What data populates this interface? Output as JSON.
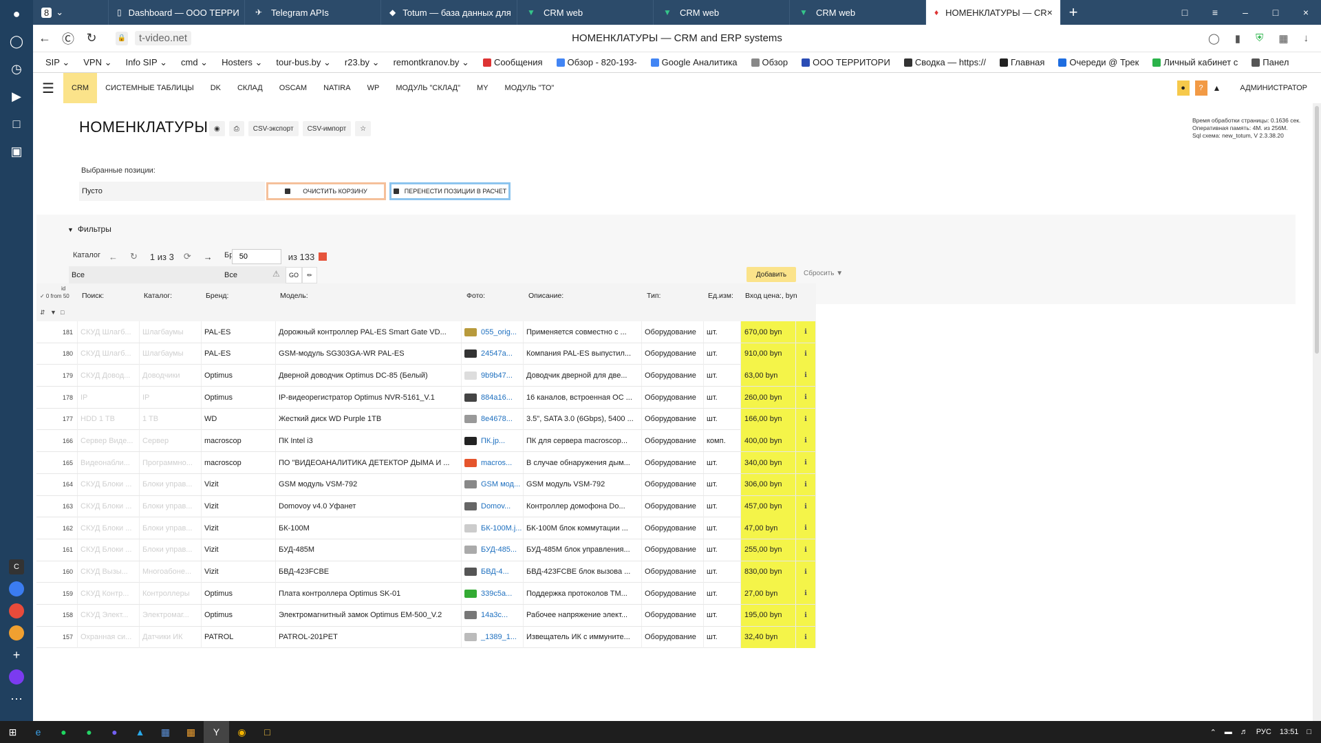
{
  "browser": {
    "tab_counter": "8",
    "tabs": [
      {
        "label": "Dashboard — ООО ТЕРРИ",
        "icon": "▯"
      },
      {
        "label": "Telegram APIs",
        "icon": "✈"
      },
      {
        "label": "Totum — база данных для",
        "icon": "◆"
      },
      {
        "label": "CRM web",
        "icon": "▼"
      },
      {
        "label": "CRM web",
        "icon": "▼"
      },
      {
        "label": "CRM web",
        "icon": "▼"
      },
      {
        "label": "НОМЕНКЛАТУРЫ — CR",
        "icon": "♦"
      }
    ],
    "url": "t-video.net",
    "page_title": "НОМЕНКЛАТУРЫ — CRM and ERP systems",
    "bookmarks": [
      "SIP ⌄",
      "VPN ⌄",
      "Info SIP ⌄",
      "cmd ⌄",
      "Hosters ⌄",
      "tour-bus.by ⌄",
      "r23.by ⌄",
      "remontkranov.by ⌄",
      "Сообщения",
      "Обзор - 820-193-",
      "Google Аналитика",
      "Обзор",
      "ООО ТЕРРИТОРИ",
      "Сводка — https://",
      "Главная",
      "Очереди @ Трек",
      "Личный кабинет с",
      "Панел"
    ]
  },
  "nav": {
    "items": [
      "CRM",
      "СИСТЕМНЫЕ ТАБЛИЦЫ",
      "DK",
      "СКЛАД",
      "OSCAM",
      "NATIRA",
      "WP",
      "МОДУЛЬ \"СКЛАД\"",
      "MY",
      "МОДУЛЬ \"ТО\""
    ],
    "active": 0,
    "user": "АДМИНИСТРАТОР",
    "help": "?"
  },
  "page": {
    "title": "НОМЕНКЛАТУРЫ",
    "csv_export": "CSV-экспорт",
    "csv_import": "CSV-импорт",
    "stats": [
      "Время обработки страницы: 0.1636 сек.",
      "Оперативная память: 4M. из 256M.",
      "Sql схема: new_totum, V 2.3.38.20"
    ],
    "selected_label": "Выбранные позиции:",
    "selected_value": "Пусто",
    "clear_cart": "ОЧИСТИТЬ КОРЗИНУ",
    "move_positions": "ПЕРЕНЕСТИ ПОЗИЦИИ В РАСЧЕТ",
    "filters_title": "Фильтры",
    "filter_catalog_label": "Каталог",
    "filter_catalog_value": "Все",
    "filter_brand_label": "Бренд",
    "filter_brand_value": "Все",
    "go": "GO",
    "pager_text": "1 из 3",
    "pager_size": "50",
    "pager_total": "из 133",
    "add_button": "Добавить",
    "reset_button": "Сбросить"
  },
  "table": {
    "id_header": "id",
    "check_header": "✓ 0 from 50",
    "headers": [
      "Поиск:",
      "Каталог:",
      "Бренд:",
      "Модель:",
      "Фото:",
      "Описание:",
      "Тип:",
      "Ед.изм:",
      "Вход цена:, byn"
    ],
    "rows": [
      {
        "id": "181",
        "search": "СКУД Шлагб...",
        "catalog": "Шлагбаумы",
        "brand": "PAL-ES",
        "model": "Дорожный контроллер PAL-ES Smart Gate VD...",
        "photo": "055_orig...",
        "desc": "Применяется совместно с ...",
        "type": "Оборудование",
        "unit": "шт.",
        "price": "670,00 byn"
      },
      {
        "id": "180",
        "search": "СКУД Шлагб...",
        "catalog": "Шлагбаумы",
        "brand": "PAL-ES",
        "model": "GSM-модуль SG303GA-WR PAL-ES",
        "photo": "24547а...",
        "desc": "Компания PAL-ES выпустил...",
        "type": "Оборудование",
        "unit": "шт.",
        "price": "910,00 byn"
      },
      {
        "id": "179",
        "search": "СКУД Довод...",
        "catalog": "Доводчики",
        "brand": "Optimus",
        "model": "Дверной доводчик Optimus DC-85 (Белый)",
        "photo": "9b9b47...",
        "desc": "Доводчик дверной для две...",
        "type": "Оборудование",
        "unit": "шт.",
        "price": "63,00 byn"
      },
      {
        "id": "178",
        "search": "IP",
        "catalog": "IP",
        "brand": "Optimus",
        "model": "IP-видеорегистратор Optimus NVR-5161_V.1",
        "photo": "884a16...",
        "desc": "16 каналов, встроенная ОС ...",
        "type": "Оборудование",
        "unit": "шт.",
        "price": "260,00 byn"
      },
      {
        "id": "177",
        "search": "HDD 1 TB",
        "catalog": "1 TB",
        "brand": "WD",
        "model": "Жесткий диск WD Purple 1TB",
        "photo": "8e4678...",
        "desc": "3.5\", SATA 3.0 (6Gbps), 5400 ...",
        "type": "Оборудование",
        "unit": "шт.",
        "price": "166,00 byn"
      },
      {
        "id": "166",
        "search": "Сервер Виде...",
        "catalog": "Сервер",
        "brand": "macroscop",
        "model": "ПК Intel i3",
        "photo": "ПК.jp...",
        "desc": "ПК для сервера macroscop...",
        "type": "Оборудование",
        "unit": "комп.",
        "price": "400,00 byn"
      },
      {
        "id": "165",
        "search": "Видеонабли...",
        "catalog": "Программно...",
        "brand": "macroscop",
        "model": "ПО \"ВИДЕОАНАЛИТИКА ДЕТЕКТОР ДЫМА И ...",
        "photo": "macros...",
        "desc": "В случае обнаружения дым...",
        "type": "Оборудование",
        "unit": "шт.",
        "price": "340,00 byn"
      },
      {
        "id": "164",
        "search": "СКУД Блоки ...",
        "catalog": "Блоки управ...",
        "brand": "Vizit",
        "model": "GSM модуль VSM-792",
        "photo": "GSM мод...",
        "desc": "GSM модуль VSM-792",
        "type": "Оборудование",
        "unit": "шт.",
        "price": "306,00 byn"
      },
      {
        "id": "163",
        "search": "СКУД Блоки ...",
        "catalog": "Блоки управ...",
        "brand": "Vizit",
        "model": "Domovoy v4.0 Уфанет",
        "photo": "Domov...",
        "desc": "Контроллер домофона Do...",
        "type": "Оборудование",
        "unit": "шт.",
        "price": "457,00 byn"
      },
      {
        "id": "162",
        "search": "СКУД Блоки ...",
        "catalog": "Блоки управ...",
        "brand": "Vizit",
        "model": "БК-100М",
        "photo": "БК-100М.j...",
        "desc": "БК-100М блок коммутации ...",
        "type": "Оборудование",
        "unit": "шт.",
        "price": "47,00 byn"
      },
      {
        "id": "161",
        "search": "СКУД Блоки ...",
        "catalog": "Блоки управ...",
        "brand": "Vizit",
        "model": "БУД-485М",
        "photo": "БУД-485...",
        "desc": "БУД-485М блок управления...",
        "type": "Оборудование",
        "unit": "шт.",
        "price": "255,00 byn"
      },
      {
        "id": "160",
        "search": "СКУД Вызы...",
        "catalog": "Многоабоне...",
        "brand": "Vizit",
        "model": "БВД-423FCBE",
        "photo": "БВД-4...",
        "desc": "БВД-423FCBE блок вызова ...",
        "type": "Оборудование",
        "unit": "шт.",
        "price": "830,00 byn"
      },
      {
        "id": "159",
        "search": "СКУД Контр...",
        "catalog": "Контроллеры",
        "brand": "Optimus",
        "model": "Плата контроллера Optimus SK-01",
        "photo": "339c5a...",
        "desc": "Поддержка протоколов TM...",
        "type": "Оборудование",
        "unit": "шт.",
        "price": "27,00 byn"
      },
      {
        "id": "158",
        "search": "СКУД Элект...",
        "catalog": "Электромаг...",
        "brand": "Optimus",
        "model": "Электромагнитный замок Optimus EM-500_V.2",
        "photo": "14a3c...",
        "desc": "Рабочее напряжение элект...",
        "type": "Оборудование",
        "unit": "шт.",
        "price": "195,00 byn"
      },
      {
        "id": "157",
        "search": "Охранная си...",
        "catalog": "Датчики ИК",
        "brand": "PATROL",
        "model": "PATROL-201PET",
        "photo": "_1389_1...",
        "desc": "Извещатель ИК с иммуните...",
        "type": "Оборудование",
        "unit": "шт.",
        "price": "32,40 byn"
      }
    ]
  },
  "taskbar": {
    "lang": "РУС",
    "time": "13:51"
  },
  "colors": {
    "accent_yellow": "#fbe38a",
    "price_yellow": "#f4f449",
    "nav_blue": "#2c4b6a"
  }
}
